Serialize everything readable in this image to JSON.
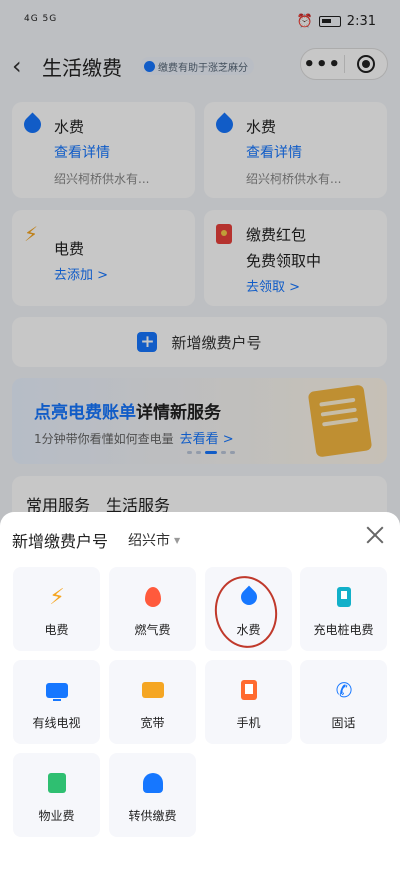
{
  "status_bar": {
    "signal_text": "4G 5G",
    "time": "2:31"
  },
  "header": {
    "title": "生活缴费",
    "badge": "缴费有助于涨芝麻分",
    "more_label": "•••"
  },
  "accounts": [
    {
      "title": "水费",
      "link": "查看详情",
      "sub": "绍兴柯桥供水有...",
      "icon": "water-drop-icon"
    },
    {
      "title": "水费",
      "link": "查看详情",
      "sub": "绍兴柯桥供水有...",
      "icon": "water-drop-icon"
    },
    {
      "title": "电费",
      "link": "去添加 >",
      "icon": "lightning-icon"
    },
    {
      "title": "缴费红包",
      "line2": "免费领取中",
      "link": "去领取 >",
      "icon": "red-packet-icon"
    }
  ],
  "add_account_label": "新增缴费户号",
  "banner": {
    "title_blue": "点亮电费账单",
    "title_dark": "详情新服务",
    "desc": "1分钟带你看懂如何查电量",
    "link": "去看看 >"
  },
  "behind_tabs": [
    "常用服务",
    "生活服务"
  ],
  "sheet": {
    "title": "新增缴费户号",
    "city": "绍兴市",
    "items": [
      {
        "label": "电费",
        "icon": "lightning-icon"
      },
      {
        "label": "燃气费",
        "icon": "flame-icon"
      },
      {
        "label": "水费",
        "icon": "water-drop-icon"
      },
      {
        "label": "充电桩电费",
        "icon": "charger-icon"
      },
      {
        "label": "有线电视",
        "icon": "tv-icon"
      },
      {
        "label": "宽带",
        "icon": "broadband-icon"
      },
      {
        "label": "手机",
        "icon": "phone-icon"
      },
      {
        "label": "固话",
        "icon": "telephone-icon"
      },
      {
        "label": "物业费",
        "icon": "property-icon"
      },
      {
        "label": "转供缴费",
        "icon": "transfer-icon"
      }
    ]
  },
  "colors": {
    "accent": "#1677ff",
    "annotation": "#c0392b"
  }
}
